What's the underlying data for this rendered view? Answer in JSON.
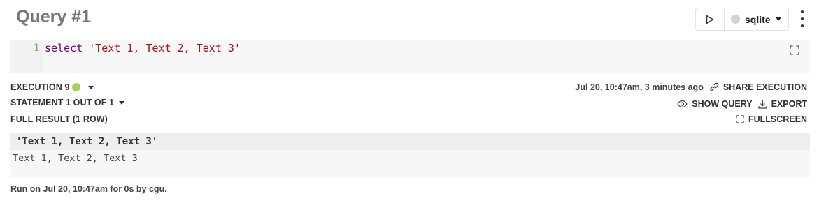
{
  "header": {
    "title": "Query #1",
    "engine_label": "sqlite",
    "run_icon": "play-icon",
    "menu_icon": "kebab-menu-icon"
  },
  "editor": {
    "line_number": "1",
    "code_keyword": "select",
    "code_string": "'Text 1, Text 2, Text 3'"
  },
  "execution": {
    "label": "EXECUTION 9",
    "status_color": "#a6d05b",
    "statement": "STATEMENT 1 OUT OF 1",
    "full_result": "FULL RESULT (1 ROW)",
    "timestamp": "Jul 20, 10:47am, 3 minutes ago",
    "share_label": "SHARE EXECUTION",
    "show_query_label": "SHOW QUERY",
    "export_label": "EXPORT",
    "fullscreen_label": "FULLSCREEN"
  },
  "result": {
    "columns": [
      "'Text 1, Text 2, Text 3'"
    ],
    "rows": [
      [
        "Text 1, Text 2, Text 3"
      ]
    ]
  },
  "footer": {
    "text": "Run on Jul 20, 10:47am for 0s by cgu."
  }
}
